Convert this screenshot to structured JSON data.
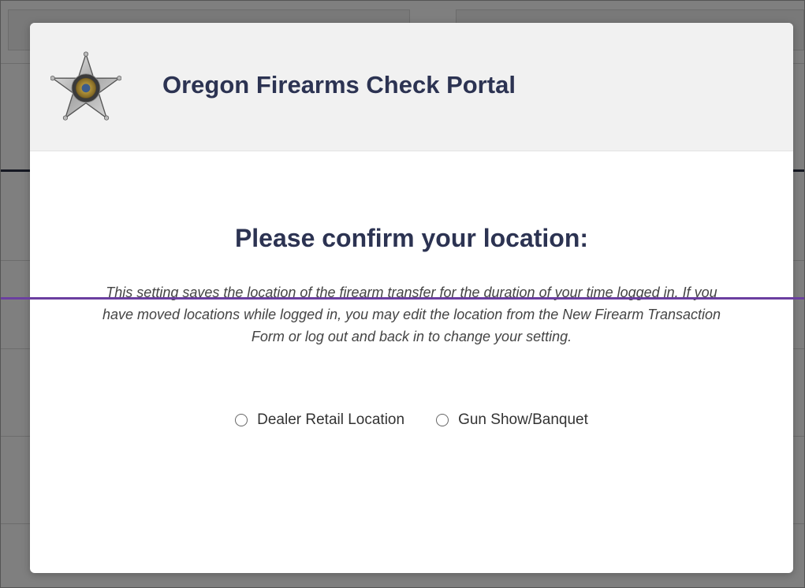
{
  "modal": {
    "title": "Oregon Firearms Check Portal",
    "badge_icon": "oregon-state-police-star-badge",
    "heading": "Please confirm your location:",
    "description": "This setting saves the location of the firearm transfer for the duration of your time logged in. If you have moved locations while logged in, you may edit the location from the New Firearm Transaction Form or log out and back in to change your setting.",
    "location_options": [
      {
        "label": "Dealer Retail Location",
        "selected": false
      },
      {
        "label": "Gun Show/Banquet",
        "selected": false
      }
    ]
  },
  "colors": {
    "title": "#2c3352",
    "header_bg": "#f1f1f1",
    "accent_line": "#6b3fa0"
  }
}
